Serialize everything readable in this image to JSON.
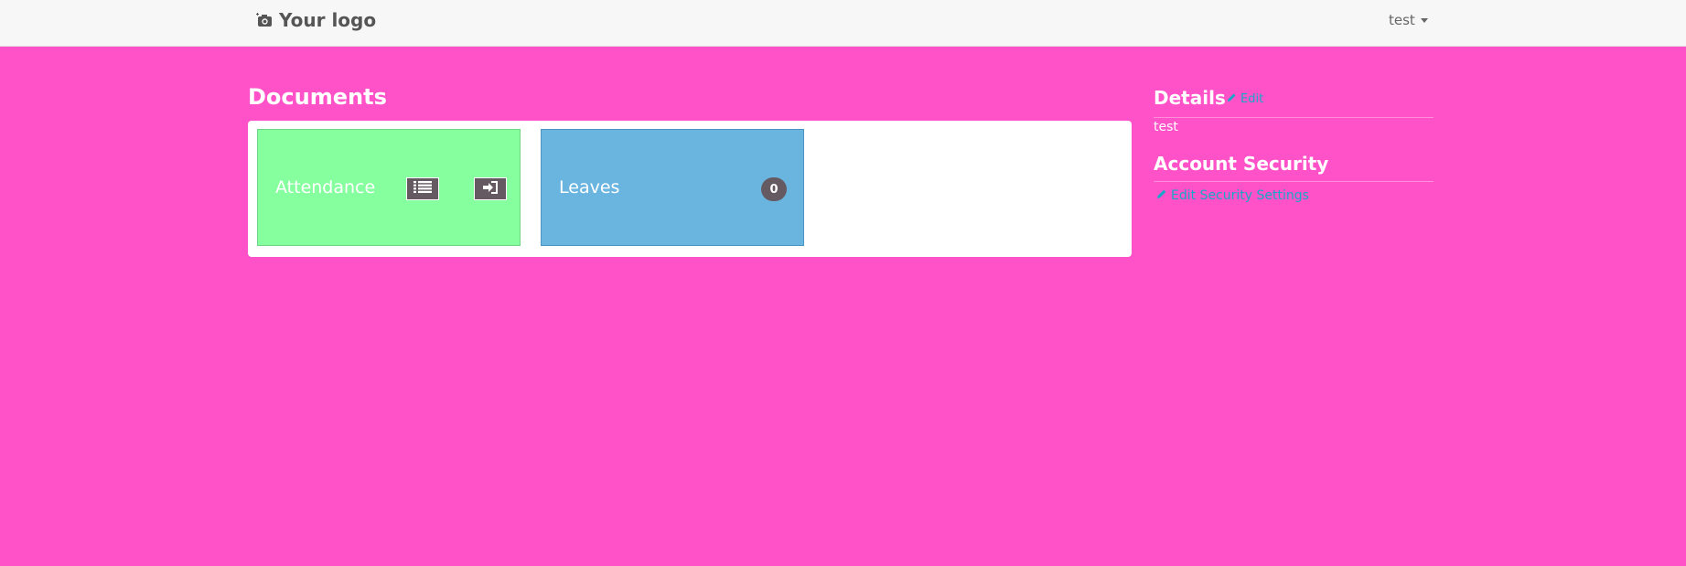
{
  "navbar": {
    "logo_text": "Your logo",
    "logo_icon": "camera-icon",
    "user_label": "test"
  },
  "documents": {
    "title": "Documents",
    "tiles": [
      {
        "label": "Attendance",
        "color": "#86ff9e",
        "buttons": [
          "list-icon",
          "sign-in-icon"
        ]
      },
      {
        "label": "Leaves",
        "color": "#6ab4e0",
        "badge": "0"
      }
    ]
  },
  "sidebar": {
    "details_title": "Details",
    "edit_label": "Edit",
    "details_value": "test",
    "security_title": "Account Security",
    "security_link": "Edit Security Settings"
  },
  "colors": {
    "background": "#ff52c8",
    "link": "#18a7c9",
    "navbar": "#f7f7f7"
  }
}
